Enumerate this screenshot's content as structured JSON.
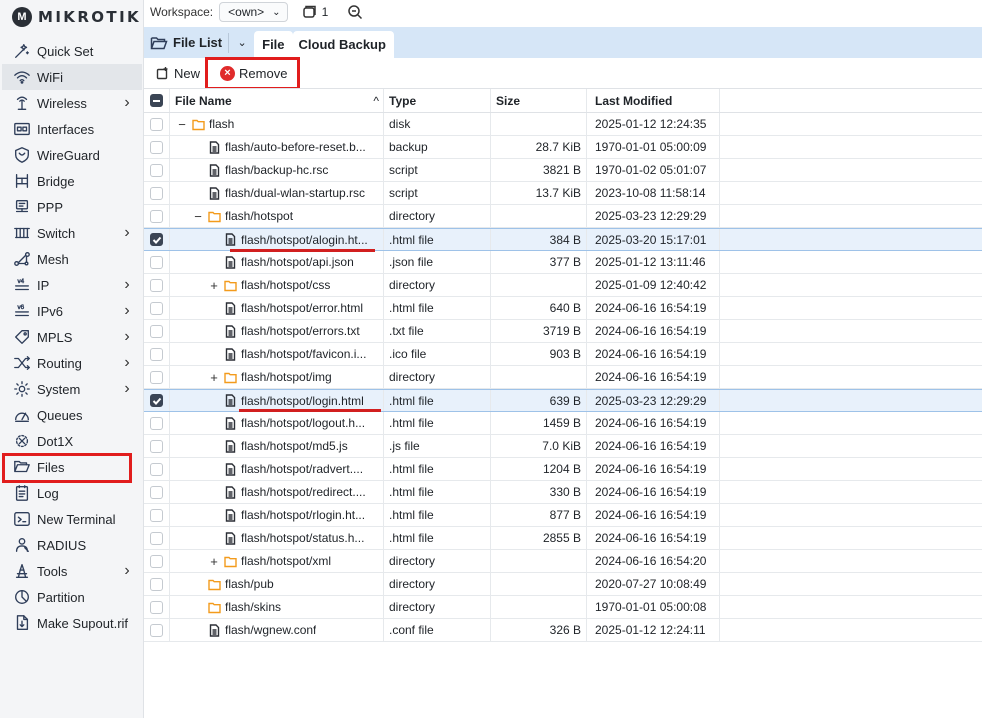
{
  "brand": "MIKROTIK",
  "sidebar": [
    {
      "label": "Quick Set",
      "icon": "quick-set-icon",
      "chevron": false
    },
    {
      "label": "WiFi",
      "icon": "wifi-icon",
      "chevron": false
    },
    {
      "label": "Wireless",
      "icon": "wireless-icon",
      "chevron": true
    },
    {
      "label": "Interfaces",
      "icon": "interfaces-icon",
      "chevron": false
    },
    {
      "label": "WireGuard",
      "icon": "wireguard-icon",
      "chevron": false
    },
    {
      "label": "Bridge",
      "icon": "bridge-icon",
      "chevron": false
    },
    {
      "label": "PPP",
      "icon": "ppp-icon",
      "chevron": false
    },
    {
      "label": "Switch",
      "icon": "switch-icon",
      "chevron": true
    },
    {
      "label": "Mesh",
      "icon": "mesh-icon",
      "chevron": false
    },
    {
      "label": "IP",
      "icon": "ip-icon",
      "chevron": true
    },
    {
      "label": "IPv6",
      "icon": "ipv6-icon",
      "chevron": true
    },
    {
      "label": "MPLS",
      "icon": "mpls-icon",
      "chevron": true
    },
    {
      "label": "Routing",
      "icon": "routing-icon",
      "chevron": true
    },
    {
      "label": "System",
      "icon": "system-icon",
      "chevron": true
    },
    {
      "label": "Queues",
      "icon": "queues-icon",
      "chevron": false
    },
    {
      "label": "Dot1X",
      "icon": "dot1x-icon",
      "chevron": false
    },
    {
      "label": "Files",
      "icon": "files-icon",
      "chevron": false
    },
    {
      "label": "Log",
      "icon": "log-icon",
      "chevron": false
    },
    {
      "label": "New Terminal",
      "icon": "terminal-icon",
      "chevron": false
    },
    {
      "label": "RADIUS",
      "icon": "radius-icon",
      "chevron": false
    },
    {
      "label": "Tools",
      "icon": "tools-icon",
      "chevron": true
    },
    {
      "label": "Partition",
      "icon": "partition-icon",
      "chevron": false
    },
    {
      "label": "Make Supout.rif",
      "icon": "supout-icon",
      "chevron": false
    }
  ],
  "workspace": {
    "label": "Workspace:",
    "value": "<own>",
    "count": "1"
  },
  "tabs": {
    "panel_title": "File List",
    "file": "File",
    "cloud_backup": "Cloud Backup"
  },
  "toolbar": {
    "new": "New",
    "remove": "Remove"
  },
  "table": {
    "columns": {
      "name": "File Name",
      "sort": "^",
      "type": "Type",
      "size": "Size",
      "modified": "Last Modified"
    },
    "rows": [
      {
        "name": "flash",
        "type": "disk",
        "size": "",
        "modified": "2025-01-12 12:24:35",
        "indent": 0,
        "expander": "−",
        "icon": "folder",
        "checked": false
      },
      {
        "name": "flash/auto-before-reset.b...",
        "type": "backup",
        "size": "28.7 KiB",
        "modified": "1970-01-01 05:00:09",
        "indent": 1,
        "expander": "",
        "icon": "file",
        "checked": false
      },
      {
        "name": "flash/backup-hc.rsc",
        "type": "script",
        "size": "3821 B",
        "modified": "1970-01-02 05:01:07",
        "indent": 1,
        "expander": "",
        "icon": "file",
        "checked": false
      },
      {
        "name": "flash/dual-wlan-startup.rsc",
        "type": "script",
        "size": "13.7 KiB",
        "modified": "2023-10-08 11:58:14",
        "indent": 1,
        "expander": "",
        "icon": "file",
        "checked": false
      },
      {
        "name": "flash/hotspot",
        "type": "directory",
        "size": "",
        "modified": "2025-03-23 12:29:29",
        "indent": 1,
        "expander": "−",
        "icon": "folder",
        "checked": false
      },
      {
        "name": "flash/hotspot/alogin.ht...",
        "type": ".html file",
        "size": "384 B",
        "modified": "2025-03-20 15:17:01",
        "indent": 2,
        "expander": "",
        "icon": "file",
        "checked": true
      },
      {
        "name": "flash/hotspot/api.json",
        "type": ".json file",
        "size": "377 B",
        "modified": "2025-01-12 13:11:46",
        "indent": 2,
        "expander": "",
        "icon": "file",
        "checked": false
      },
      {
        "name": "flash/hotspot/css",
        "type": "directory",
        "size": "",
        "modified": "2025-01-09 12:40:42",
        "indent": 2,
        "expander": "+",
        "icon": "folder",
        "checked": false
      },
      {
        "name": "flash/hotspot/error.html",
        "type": ".html file",
        "size": "640 B",
        "modified": "2024-06-16 16:54:19",
        "indent": 2,
        "expander": "",
        "icon": "file",
        "checked": false
      },
      {
        "name": "flash/hotspot/errors.txt",
        "type": ".txt file",
        "size": "3719 B",
        "modified": "2024-06-16 16:54:19",
        "indent": 2,
        "expander": "",
        "icon": "file",
        "checked": false
      },
      {
        "name": "flash/hotspot/favicon.i...",
        "type": ".ico file",
        "size": "903 B",
        "modified": "2024-06-16 16:54:19",
        "indent": 2,
        "expander": "",
        "icon": "file",
        "checked": false
      },
      {
        "name": "flash/hotspot/img",
        "type": "directory",
        "size": "",
        "modified": "2024-06-16 16:54:19",
        "indent": 2,
        "expander": "+",
        "icon": "folder",
        "checked": false
      },
      {
        "name": "flash/hotspot/login.html",
        "type": ".html file",
        "size": "639 B",
        "modified": "2025-03-23 12:29:29",
        "indent": 2,
        "expander": "",
        "icon": "file",
        "checked": true
      },
      {
        "name": "flash/hotspot/logout.h...",
        "type": ".html file",
        "size": "1459 B",
        "modified": "2024-06-16 16:54:19",
        "indent": 2,
        "expander": "",
        "icon": "file",
        "checked": false
      },
      {
        "name": "flash/hotspot/md5.js",
        "type": ".js file",
        "size": "7.0 KiB",
        "modified": "2024-06-16 16:54:19",
        "indent": 2,
        "expander": "",
        "icon": "file",
        "checked": false
      },
      {
        "name": "flash/hotspot/radvert....",
        "type": ".html file",
        "size": "1204 B",
        "modified": "2024-06-16 16:54:19",
        "indent": 2,
        "expander": "",
        "icon": "file",
        "checked": false
      },
      {
        "name": "flash/hotspot/redirect....",
        "type": ".html file",
        "size": "330 B",
        "modified": "2024-06-16 16:54:19",
        "indent": 2,
        "expander": "",
        "icon": "file",
        "checked": false
      },
      {
        "name": "flash/hotspot/rlogin.ht...",
        "type": ".html file",
        "size": "877 B",
        "modified": "2024-06-16 16:54:19",
        "indent": 2,
        "expander": "",
        "icon": "file",
        "checked": false
      },
      {
        "name": "flash/hotspot/status.h...",
        "type": ".html file",
        "size": "2855 B",
        "modified": "2024-06-16 16:54:19",
        "indent": 2,
        "expander": "",
        "icon": "file",
        "checked": false
      },
      {
        "name": "flash/hotspot/xml",
        "type": "directory",
        "size": "",
        "modified": "2024-06-16 16:54:20",
        "indent": 2,
        "expander": "+",
        "icon": "folder",
        "checked": false
      },
      {
        "name": "flash/pub",
        "type": "directory",
        "size": "",
        "modified": "2020-07-27 10:08:49",
        "indent": 1,
        "expander": "",
        "icon": "folder",
        "checked": false
      },
      {
        "name": "flash/skins",
        "type": "directory",
        "size": "",
        "modified": "1970-01-01 05:00:08",
        "indent": 1,
        "expander": "",
        "icon": "folder",
        "checked": false
      },
      {
        "name": "flash/wgnew.conf",
        "type": ".conf file",
        "size": "326 B",
        "modified": "2025-01-12 12:24:11",
        "indent": 1,
        "expander": "",
        "icon": "file",
        "checked": false
      }
    ]
  },
  "colors": {
    "accent_bar": "#d6e6f7",
    "highlight": "#e11d1d",
    "folder": "#f39b1c",
    "remove": "#e02b2b"
  }
}
